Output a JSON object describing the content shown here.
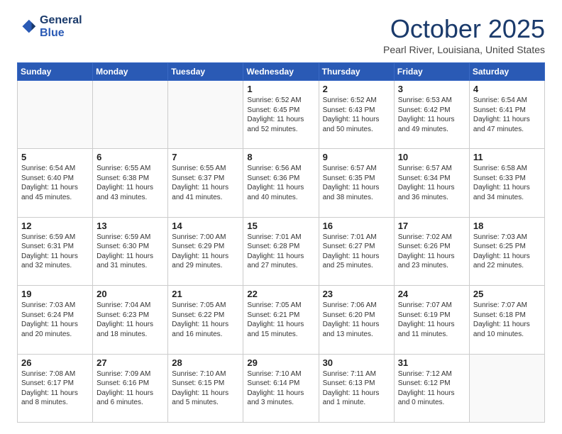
{
  "logo": {
    "line1": "General",
    "line2": "Blue"
  },
  "calendar": {
    "title": "October 2025",
    "subtitle": "Pearl River, Louisiana, United States",
    "days_of_week": [
      "Sunday",
      "Monday",
      "Tuesday",
      "Wednesday",
      "Thursday",
      "Friday",
      "Saturday"
    ],
    "weeks": [
      [
        {
          "day": "",
          "info": ""
        },
        {
          "day": "",
          "info": ""
        },
        {
          "day": "",
          "info": ""
        },
        {
          "day": "1",
          "info": "Sunrise: 6:52 AM\nSunset: 6:45 PM\nDaylight: 11 hours\nand 52 minutes."
        },
        {
          "day": "2",
          "info": "Sunrise: 6:52 AM\nSunset: 6:43 PM\nDaylight: 11 hours\nand 50 minutes."
        },
        {
          "day": "3",
          "info": "Sunrise: 6:53 AM\nSunset: 6:42 PM\nDaylight: 11 hours\nand 49 minutes."
        },
        {
          "day": "4",
          "info": "Sunrise: 6:54 AM\nSunset: 6:41 PM\nDaylight: 11 hours\nand 47 minutes."
        }
      ],
      [
        {
          "day": "5",
          "info": "Sunrise: 6:54 AM\nSunset: 6:40 PM\nDaylight: 11 hours\nand 45 minutes."
        },
        {
          "day": "6",
          "info": "Sunrise: 6:55 AM\nSunset: 6:38 PM\nDaylight: 11 hours\nand 43 minutes."
        },
        {
          "day": "7",
          "info": "Sunrise: 6:55 AM\nSunset: 6:37 PM\nDaylight: 11 hours\nand 41 minutes."
        },
        {
          "day": "8",
          "info": "Sunrise: 6:56 AM\nSunset: 6:36 PM\nDaylight: 11 hours\nand 40 minutes."
        },
        {
          "day": "9",
          "info": "Sunrise: 6:57 AM\nSunset: 6:35 PM\nDaylight: 11 hours\nand 38 minutes."
        },
        {
          "day": "10",
          "info": "Sunrise: 6:57 AM\nSunset: 6:34 PM\nDaylight: 11 hours\nand 36 minutes."
        },
        {
          "day": "11",
          "info": "Sunrise: 6:58 AM\nSunset: 6:33 PM\nDaylight: 11 hours\nand 34 minutes."
        }
      ],
      [
        {
          "day": "12",
          "info": "Sunrise: 6:59 AM\nSunset: 6:31 PM\nDaylight: 11 hours\nand 32 minutes."
        },
        {
          "day": "13",
          "info": "Sunrise: 6:59 AM\nSunset: 6:30 PM\nDaylight: 11 hours\nand 31 minutes."
        },
        {
          "day": "14",
          "info": "Sunrise: 7:00 AM\nSunset: 6:29 PM\nDaylight: 11 hours\nand 29 minutes."
        },
        {
          "day": "15",
          "info": "Sunrise: 7:01 AM\nSunset: 6:28 PM\nDaylight: 11 hours\nand 27 minutes."
        },
        {
          "day": "16",
          "info": "Sunrise: 7:01 AM\nSunset: 6:27 PM\nDaylight: 11 hours\nand 25 minutes."
        },
        {
          "day": "17",
          "info": "Sunrise: 7:02 AM\nSunset: 6:26 PM\nDaylight: 11 hours\nand 23 minutes."
        },
        {
          "day": "18",
          "info": "Sunrise: 7:03 AM\nSunset: 6:25 PM\nDaylight: 11 hours\nand 22 minutes."
        }
      ],
      [
        {
          "day": "19",
          "info": "Sunrise: 7:03 AM\nSunset: 6:24 PM\nDaylight: 11 hours\nand 20 minutes."
        },
        {
          "day": "20",
          "info": "Sunrise: 7:04 AM\nSunset: 6:23 PM\nDaylight: 11 hours\nand 18 minutes."
        },
        {
          "day": "21",
          "info": "Sunrise: 7:05 AM\nSunset: 6:22 PM\nDaylight: 11 hours\nand 16 minutes."
        },
        {
          "day": "22",
          "info": "Sunrise: 7:05 AM\nSunset: 6:21 PM\nDaylight: 11 hours\nand 15 minutes."
        },
        {
          "day": "23",
          "info": "Sunrise: 7:06 AM\nSunset: 6:20 PM\nDaylight: 11 hours\nand 13 minutes."
        },
        {
          "day": "24",
          "info": "Sunrise: 7:07 AM\nSunset: 6:19 PM\nDaylight: 11 hours\nand 11 minutes."
        },
        {
          "day": "25",
          "info": "Sunrise: 7:07 AM\nSunset: 6:18 PM\nDaylight: 11 hours\nand 10 minutes."
        }
      ],
      [
        {
          "day": "26",
          "info": "Sunrise: 7:08 AM\nSunset: 6:17 PM\nDaylight: 11 hours\nand 8 minutes."
        },
        {
          "day": "27",
          "info": "Sunrise: 7:09 AM\nSunset: 6:16 PM\nDaylight: 11 hours\nand 6 minutes."
        },
        {
          "day": "28",
          "info": "Sunrise: 7:10 AM\nSunset: 6:15 PM\nDaylight: 11 hours\nand 5 minutes."
        },
        {
          "day": "29",
          "info": "Sunrise: 7:10 AM\nSunset: 6:14 PM\nDaylight: 11 hours\nand 3 minutes."
        },
        {
          "day": "30",
          "info": "Sunrise: 7:11 AM\nSunset: 6:13 PM\nDaylight: 11 hours\nand 1 minute."
        },
        {
          "day": "31",
          "info": "Sunrise: 7:12 AM\nSunset: 6:12 PM\nDaylight: 11 hours\nand 0 minutes."
        },
        {
          "day": "",
          "info": ""
        }
      ]
    ]
  }
}
